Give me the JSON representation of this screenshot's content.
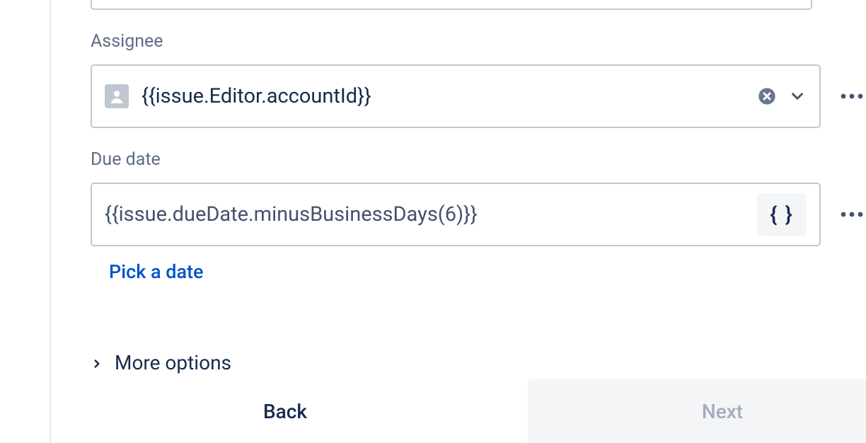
{
  "fields": {
    "assignee": {
      "label": "Assignee",
      "value": "{{issue.Editor.accountId}}"
    },
    "dueDate": {
      "label": "Due date",
      "value": "{{issue.dueDate.minusBusinessDays(6)}}",
      "codeChip": "{ }",
      "pickADate": "Pick a date"
    }
  },
  "moreOptions": "More options",
  "buttons": {
    "back": "Back",
    "next": "Next"
  }
}
